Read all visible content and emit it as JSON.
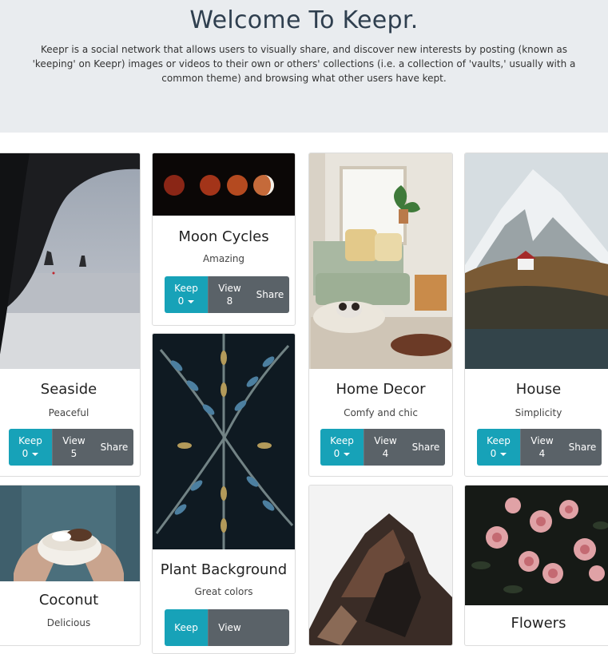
{
  "hero": {
    "title": "Welcome To Keepr.",
    "description": "Keepr is a social network that allows users to visually share, and discover new interests by posting (known as 'keeping' on Keepr) images or videos to their own or others' collections (i.e. a collection of 'vaults,' usually with a common theme) and browsing what other users have kept."
  },
  "buttons": {
    "keep_label": "Keep",
    "view_label": "View",
    "share_label": "Share"
  },
  "keeps": [
    {
      "title": "Seaside",
      "description": "Peaceful",
      "keeps": "0",
      "views": "5",
      "image": "seaside-cave-beach"
    },
    {
      "title": "Moon Cycles",
      "description": "Amazing",
      "keeps": "0",
      "views": "8",
      "image": "lunar-eclipse-phases"
    },
    {
      "title": "Home Decor",
      "description": "Comfy and chic",
      "keeps": "0",
      "views": "4",
      "image": "living-room-dog"
    },
    {
      "title": "House",
      "description": "Simplicity",
      "keeps": "0",
      "views": "4",
      "image": "snowy-mountain-house"
    },
    {
      "title": "Coconut",
      "description": "Delicious",
      "image": "hands-holding-coconut"
    },
    {
      "title": "Plant Background",
      "description": "Great colors",
      "keeps": "",
      "views": "",
      "image": "fern-leaves"
    },
    {
      "title": "",
      "description": "",
      "image": "rock-formation"
    },
    {
      "title": "Flowers",
      "description": "",
      "image": "pink-roses"
    }
  ],
  "colors": {
    "hero_bg": "#e9ecef",
    "keep": "#17a2b8",
    "secondary": "#5a6268"
  }
}
